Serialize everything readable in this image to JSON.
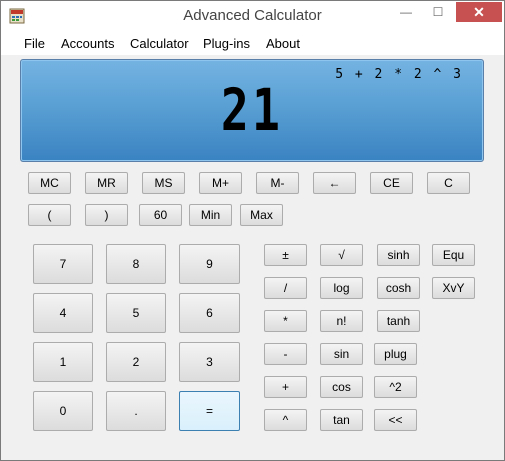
{
  "window": {
    "title": "Advanced Calculator",
    "minimize_label": "—",
    "maximize_label": "☐",
    "close_label": "✕"
  },
  "menu": [
    "File",
    "Accounts",
    "Calculator",
    "Plug-ins",
    "About"
  ],
  "display": {
    "expression": "5 + 2 * 2 ^ 3",
    "result": "21"
  },
  "memory_row": [
    "MC",
    "MR",
    "MS",
    "M+",
    "M-",
    "←",
    "CE",
    "C"
  ],
  "second_row": [
    "(",
    ")",
    "60",
    "Min",
    "Max"
  ],
  "keypad": [
    "7",
    "8",
    "9",
    "4",
    "5",
    "6",
    "1",
    "2",
    "3",
    "0",
    ".",
    "="
  ],
  "operators": [
    "±",
    "/",
    "*",
    "-",
    "+",
    "^"
  ],
  "functions_col1": [
    "√",
    "log",
    "n!",
    "sin",
    "cos",
    "tan"
  ],
  "functions_col2": [
    "sinh",
    "cosh",
    "tanh",
    "plug",
    "^2",
    "<<"
  ],
  "functions_col3": [
    "Equ",
    "XvY"
  ]
}
